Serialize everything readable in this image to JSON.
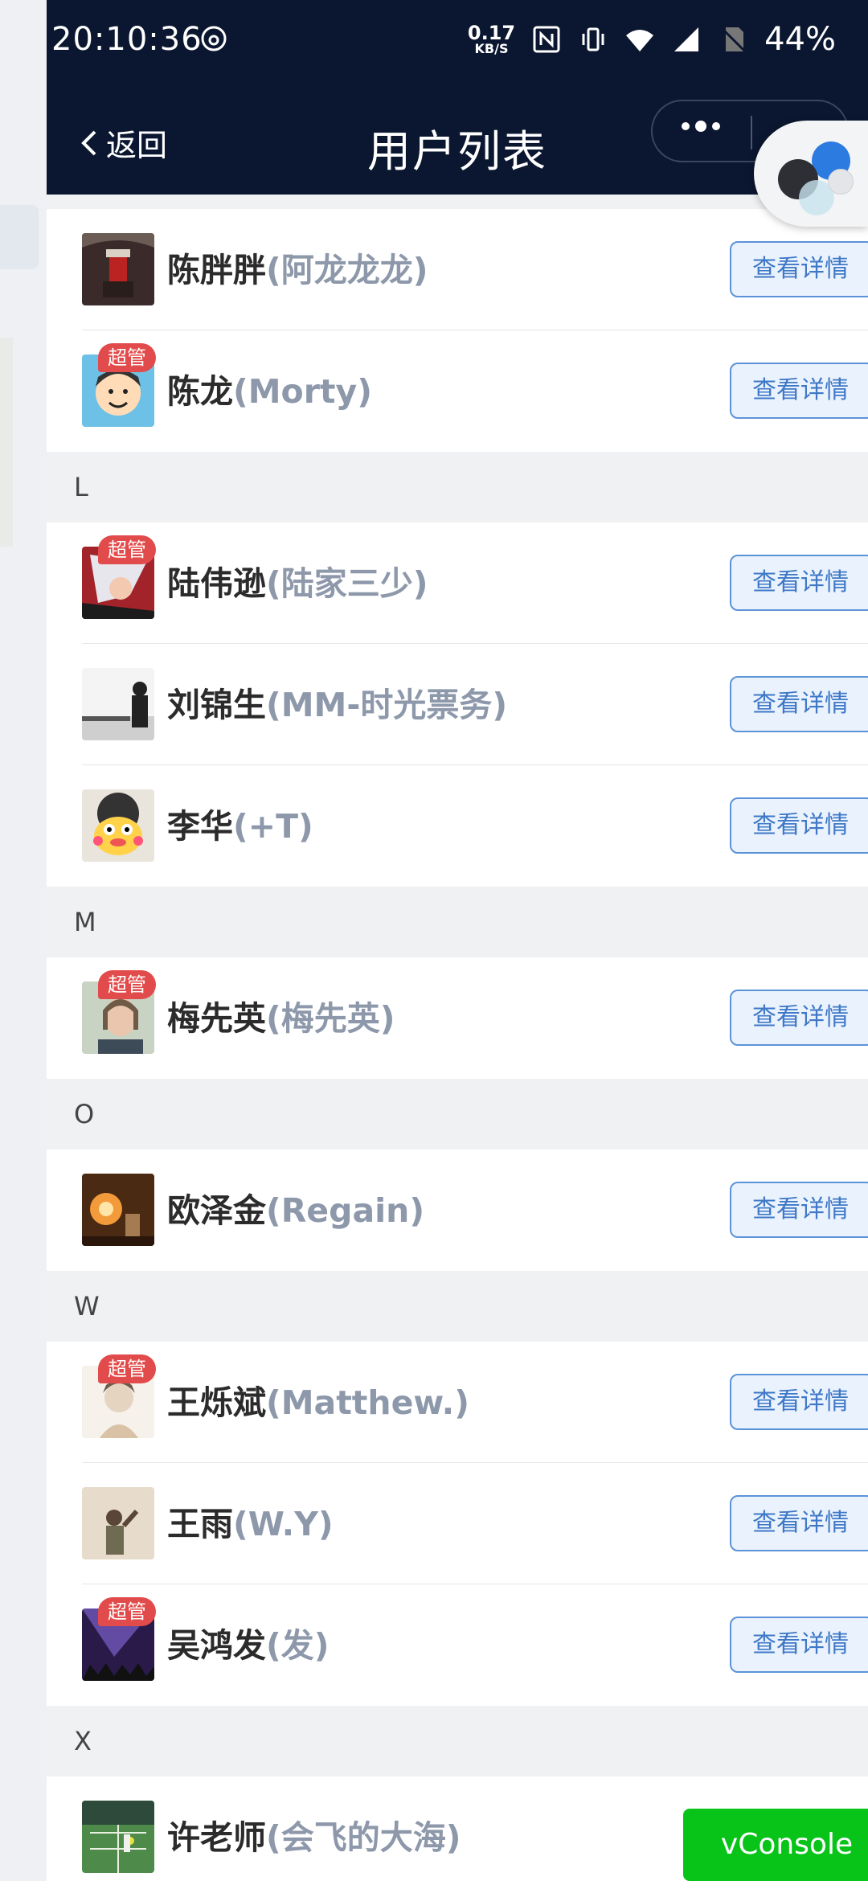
{
  "status_bar": {
    "time": "20:10:36",
    "net_speed_value": "0.17",
    "net_speed_unit": "KB/S",
    "battery": "44%"
  },
  "nav": {
    "back_label": "返回",
    "title": "用户列表"
  },
  "detail_label": "查看详情",
  "badge_label": "超管",
  "sections": [
    {
      "letter": "",
      "rows": [
        {
          "real": "陈胖胖",
          "nick": "(阿龙龙龙)",
          "admin": false,
          "avatar": "pagoda"
        },
        {
          "real": "陈龙",
          "nick": "(Morty)",
          "admin": true,
          "avatar": "cartoon"
        }
      ]
    },
    {
      "letter": "L",
      "rows": [
        {
          "real": "陆伟逊",
          "nick": "(陆家三少)",
          "admin": true,
          "avatar": "anime"
        },
        {
          "real": "刘锦生",
          "nick": "(MM-时光票务)",
          "admin": false,
          "avatar": "silhouette"
        },
        {
          "real": "李华",
          "nick": "(+T)",
          "admin": false,
          "avatar": "duck"
        }
      ]
    },
    {
      "letter": "M",
      "rows": [
        {
          "real": "梅先英",
          "nick": "(梅先英)",
          "admin": true,
          "avatar": "woman"
        }
      ]
    },
    {
      "letter": "O",
      "rows": [
        {
          "real": "欧泽金",
          "nick": "(Regain)",
          "admin": false,
          "avatar": "lamp"
        }
      ]
    },
    {
      "letter": "W",
      "rows": [
        {
          "real": "王烁斌",
          "nick": "(Matthew.)",
          "admin": true,
          "avatar": "sketch"
        },
        {
          "real": "王雨",
          "nick": "(W.Y)",
          "admin": false,
          "avatar": "person"
        },
        {
          "real": "吴鸿发",
          "nick": "(发)",
          "admin": true,
          "avatar": "concert"
        }
      ]
    },
    {
      "letter": "X",
      "rows": [
        {
          "real": "许老师",
          "nick": "(会飞的大海)",
          "admin": false,
          "avatar": "court"
        }
      ]
    }
  ],
  "vconsole_label": "vConsole"
}
